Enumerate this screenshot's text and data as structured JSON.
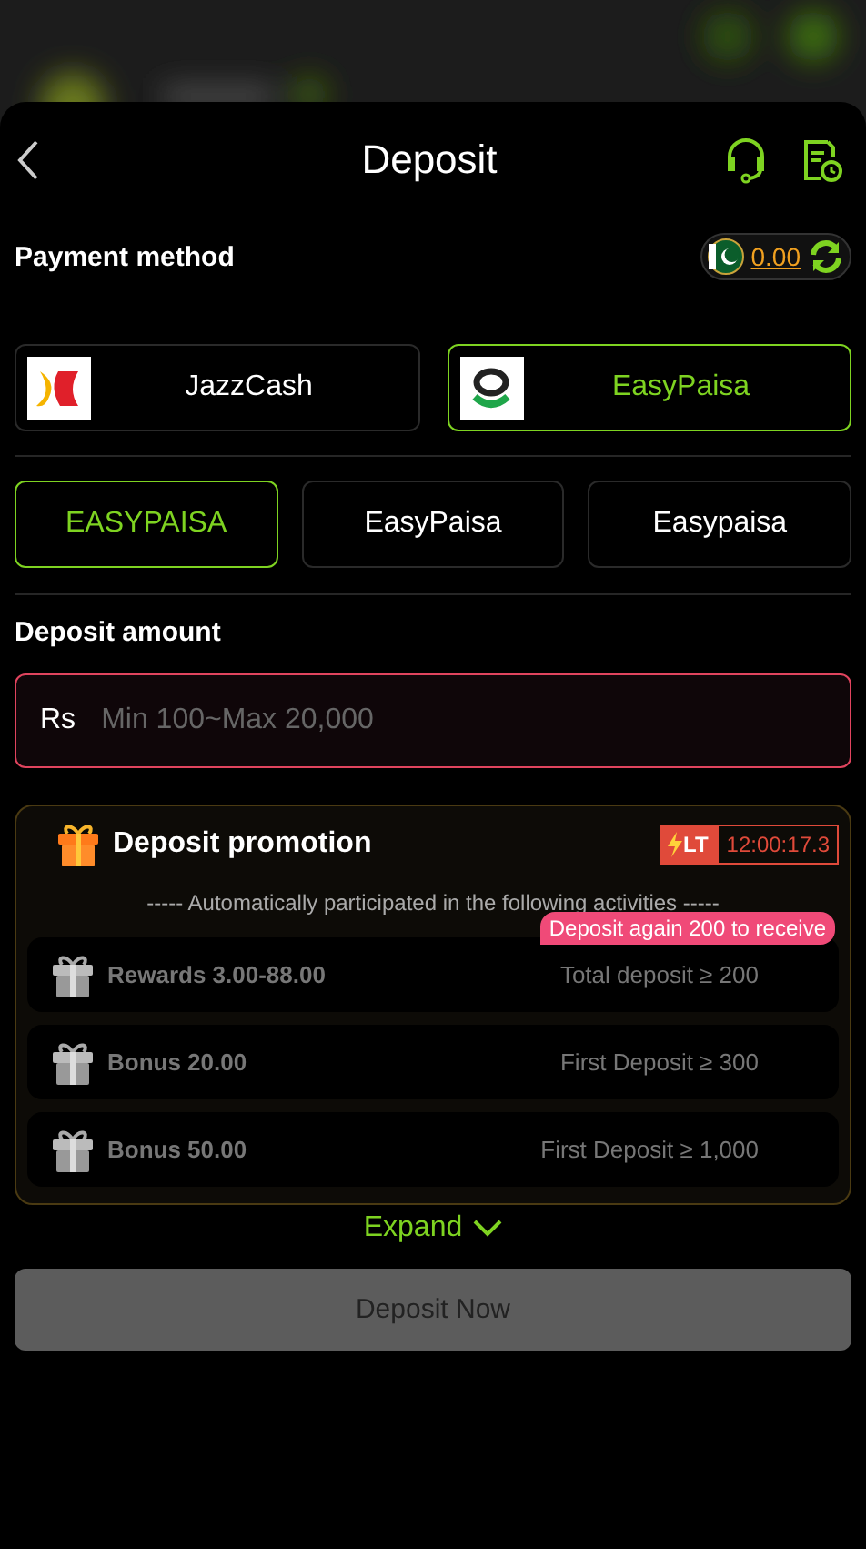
{
  "header": {
    "title": "Deposit"
  },
  "payment_method": {
    "label": "Payment method",
    "balance": "0.00"
  },
  "methods": [
    {
      "name": "JazzCash",
      "kind": "jazz",
      "selected": false
    },
    {
      "name": "EasyPaisa",
      "kind": "easy",
      "selected": true
    }
  ],
  "channels": [
    {
      "label": "EASYPAISA",
      "selected": true
    },
    {
      "label": "EasyPaisa",
      "selected": false
    },
    {
      "label": "Easypaisa",
      "selected": false
    }
  ],
  "amount": {
    "label": "Deposit amount",
    "currency": "Rs",
    "placeholder": "Min 100~Max 20,000"
  },
  "promotion": {
    "title": "Deposit promotion",
    "badge": "LT",
    "timer": "12:00:17.3",
    "subtitle": "----- Automatically participated in the following activities -----",
    "items": [
      {
        "name": "Rewards 3.00-88.00",
        "condition": "Total deposit ≥ 200",
        "tip": "Deposit again 200 to receive"
      },
      {
        "name": "Bonus 20.00",
        "condition": "First Deposit ≥ 300"
      },
      {
        "name": "Bonus 50.00",
        "condition": "First Deposit ≥ 1,000"
      }
    ]
  },
  "expand": "Expand",
  "submit": {
    "label": "Deposit Now",
    "disabled": true
  }
}
